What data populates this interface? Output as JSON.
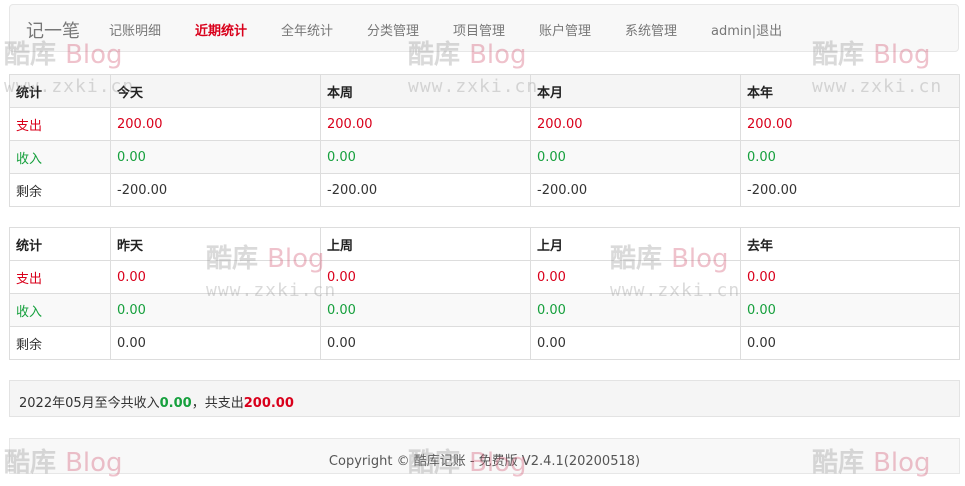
{
  "nav": {
    "brand": "记一笔",
    "items": [
      {
        "label": "记账明细"
      },
      {
        "label": "近期统计"
      },
      {
        "label": "全年统计"
      },
      {
        "label": "分类管理"
      },
      {
        "label": "项目管理"
      },
      {
        "label": "账户管理"
      },
      {
        "label": "系统管理"
      },
      {
        "label": "admin|退出"
      }
    ],
    "active_index": 1
  },
  "table1": {
    "headers": [
      "统计",
      "今天",
      "本周",
      "本月",
      "本年"
    ],
    "rows": [
      {
        "label": "支出",
        "values": [
          "200.00",
          "200.00",
          "200.00",
          "200.00"
        ]
      },
      {
        "label": "收入",
        "values": [
          "0.00",
          "0.00",
          "0.00",
          "0.00"
        ]
      },
      {
        "label": "剩余",
        "values": [
          "-200.00",
          "-200.00",
          "-200.00",
          "-200.00"
        ]
      }
    ]
  },
  "table2": {
    "headers": [
      "统计",
      "昨天",
      "上周",
      "上月",
      "去年"
    ],
    "rows": [
      {
        "label": "支出",
        "values": [
          "0.00",
          "0.00",
          "0.00",
          "0.00"
        ]
      },
      {
        "label": "收入",
        "values": [
          "0.00",
          "0.00",
          "0.00",
          "0.00"
        ]
      },
      {
        "label": "剩余",
        "values": [
          "0.00",
          "0.00",
          "0.00",
          "0.00"
        ]
      }
    ]
  },
  "summary": {
    "prefix": "2022年05月至今共收入",
    "income": "0.00",
    "middle": "，共支出",
    "expense": "200.00"
  },
  "footer": {
    "text": "Copyright © 酷库记账 - 免费版 V2.4.1(20200518)"
  },
  "watermark": {
    "logo_cn": "酷库",
    "logo_en": "Blog",
    "url": "www.zxki.cn"
  },
  "colors": {
    "expense": "#d9001b",
    "income": "#16a03d",
    "active_nav": "#d9001b"
  }
}
